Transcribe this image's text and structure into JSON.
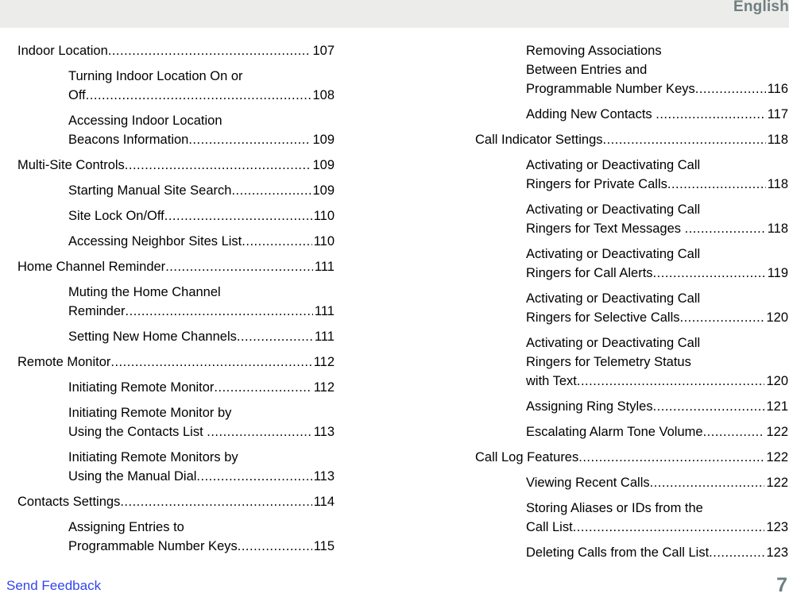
{
  "header": {
    "language": "English",
    "band_color": "#ececea",
    "text_color": "#6e7f80"
  },
  "footer": {
    "feedback_label": "Send Feedback",
    "feedback_color": "#3344ee",
    "page_number": "7",
    "page_number_color": "#6e7f80"
  },
  "toc": {
    "columns": [
      {
        "entries": [
          {
            "level": 1,
            "lines": [
              "Indoor Location"
            ],
            "page": "107"
          },
          {
            "level": 2,
            "lines": [
              "Turning Indoor Location On or",
              "Off"
            ],
            "page": "108"
          },
          {
            "level": 2,
            "lines": [
              "Accessing Indoor Location",
              "Beacons Information"
            ],
            "page": "109"
          },
          {
            "level": 1,
            "lines": [
              "Multi-Site Controls"
            ],
            "page": "109"
          },
          {
            "level": 2,
            "lines": [
              "Starting Manual Site Search"
            ],
            "page": "109"
          },
          {
            "level": 2,
            "lines": [
              "Site Lock On/Off"
            ],
            "page": "110"
          },
          {
            "level": 2,
            "lines": [
              "Accessing Neighbor Sites List"
            ],
            "page": "110"
          },
          {
            "level": 1,
            "lines": [
              "Home Channel Reminder"
            ],
            "page": "111"
          },
          {
            "level": 2,
            "lines": [
              "Muting the Home Channel",
              "Reminder"
            ],
            "page": "111"
          },
          {
            "level": 2,
            "lines": [
              "Setting New Home Channels"
            ],
            "page": "111"
          },
          {
            "level": 1,
            "lines": [
              "Remote Monitor"
            ],
            "page": "112"
          },
          {
            "level": 2,
            "lines": [
              "Initiating Remote Monitor"
            ],
            "page": "112"
          },
          {
            "level": 2,
            "lines": [
              "Initiating Remote Monitor by",
              "Using the Contacts List"
            ],
            "page": "113",
            "gap": true
          },
          {
            "level": 2,
            "lines": [
              "Initiating Remote Monitors by",
              "Using the Manual Dial"
            ],
            "page": "113"
          },
          {
            "level": 1,
            "lines": [
              "Contacts Settings"
            ],
            "page": "114"
          },
          {
            "level": 2,
            "lines": [
              "Assigning Entries to",
              "Programmable Number Keys"
            ],
            "page": "115"
          }
        ]
      },
      {
        "entries": [
          {
            "level": 2,
            "lines": [
              "Removing Associations",
              "Between Entries and",
              "Programmable Number Keys"
            ],
            "page": "116"
          },
          {
            "level": 2,
            "lines": [
              "Adding New Contacts"
            ],
            "page": "117",
            "gap": true
          },
          {
            "level": 1,
            "lines": [
              "Call Indicator Settings"
            ],
            "page": "118"
          },
          {
            "level": 2,
            "lines": [
              "Activating or Deactivating Call",
              "Ringers for Private Calls"
            ],
            "page": "118"
          },
          {
            "level": 2,
            "lines": [
              "Activating or Deactivating Call",
              "Ringers for Text Messages"
            ],
            "page": "118",
            "gap": true
          },
          {
            "level": 2,
            "lines": [
              "Activating or Deactivating Call",
              "Ringers for Call Alerts"
            ],
            "page": "119"
          },
          {
            "level": 2,
            "lines": [
              "Activating or Deactivating Call",
              "Ringers for Selective Calls"
            ],
            "page": "120"
          },
          {
            "level": 2,
            "lines": [
              "Activating or Deactivating Call",
              "Ringers for Telemetry Status",
              "with Text"
            ],
            "page": "120"
          },
          {
            "level": 2,
            "lines": [
              "Assigning Ring Styles"
            ],
            "page": "121"
          },
          {
            "level": 2,
            "lines": [
              "Escalating Alarm Tone Volume"
            ],
            "page": "122"
          },
          {
            "level": 1,
            "lines": [
              "Call Log Features"
            ],
            "page": "122"
          },
          {
            "level": 2,
            "lines": [
              "Viewing Recent Calls"
            ],
            "page": "122"
          },
          {
            "level": 2,
            "lines": [
              "Storing Aliases or IDs from the",
              "Call List"
            ],
            "page": "123"
          },
          {
            "level": 2,
            "lines": [
              "Deleting Calls from the Call List"
            ],
            "page": "123"
          }
        ]
      }
    ]
  }
}
